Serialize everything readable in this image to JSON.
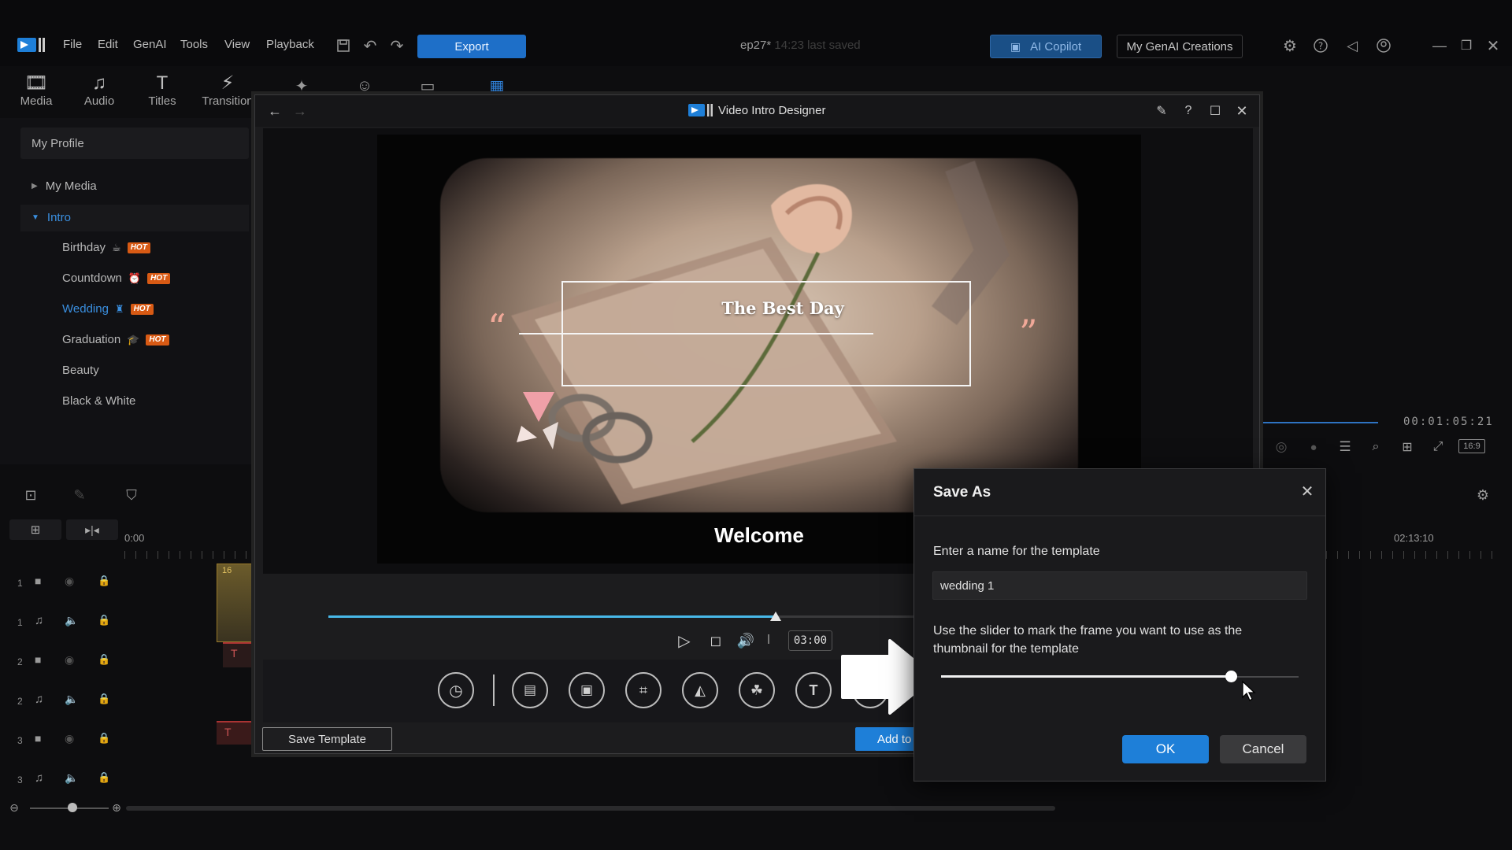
{
  "colors": {
    "accent": "#1e7fd8",
    "hot": "#d85a14",
    "selected_text": "#3a8fe0",
    "progress": "#48b8e8"
  },
  "titlebar": {
    "menu": [
      "File",
      "Edit",
      "GenAI",
      "Tools",
      "View",
      "Playback"
    ],
    "export_label": "Export",
    "project_name": "ep27*",
    "last_saved": "14:23 last saved",
    "ai_copilot_label": "AI Copilot",
    "genai_creations_label": "My GenAI Creations"
  },
  "tooltabs": [
    {
      "label": "Media",
      "icon": "media-room-icon"
    },
    {
      "label": "Audio",
      "icon": "music-note-icon"
    },
    {
      "label": "Titles",
      "icon": "title-t-icon"
    },
    {
      "label": "Transition",
      "icon": "transition-icon"
    }
  ],
  "library": {
    "profile_label": "My Profile",
    "my_media_label": "My Media",
    "intro_label": "Intro",
    "items": [
      {
        "label": "Birthday",
        "hot": "HOT",
        "selected": false
      },
      {
        "label": "Countdown",
        "hot": "HOT",
        "selected": false
      },
      {
        "label": "Wedding",
        "hot": "HOT",
        "selected": true
      },
      {
        "label": "Graduation",
        "hot": "HOT",
        "selected": false
      },
      {
        "label": "Beauty",
        "hot": "",
        "selected": false
      },
      {
        "label": "Black & White",
        "hot": "",
        "selected": false
      }
    ]
  },
  "timeline": {
    "start_time": "0:00",
    "end_time": "02:13:10",
    "preview_time": "00:01:05:21",
    "aspect_label": "16:9",
    "clip_badge": "16",
    "tracks": [
      "1",
      "1",
      "2",
      "2",
      "3",
      "3"
    ]
  },
  "designer": {
    "title": "Video Intro Designer",
    "preview_title": "The Best Day",
    "preview_subtitle": "Welcome",
    "time": "03:00",
    "progress": 0.66,
    "save_template_label": "Save Template",
    "add_label": "Add to"
  },
  "dialog": {
    "title": "Save As",
    "prompt": "Enter a name for the template",
    "name_value": "wedding 1",
    "slider_hint": "Use the slider to mark the frame you want to use as the thumbnail for the template",
    "slider_value": 0.81,
    "ok_label": "OK",
    "cancel_label": "Cancel"
  }
}
